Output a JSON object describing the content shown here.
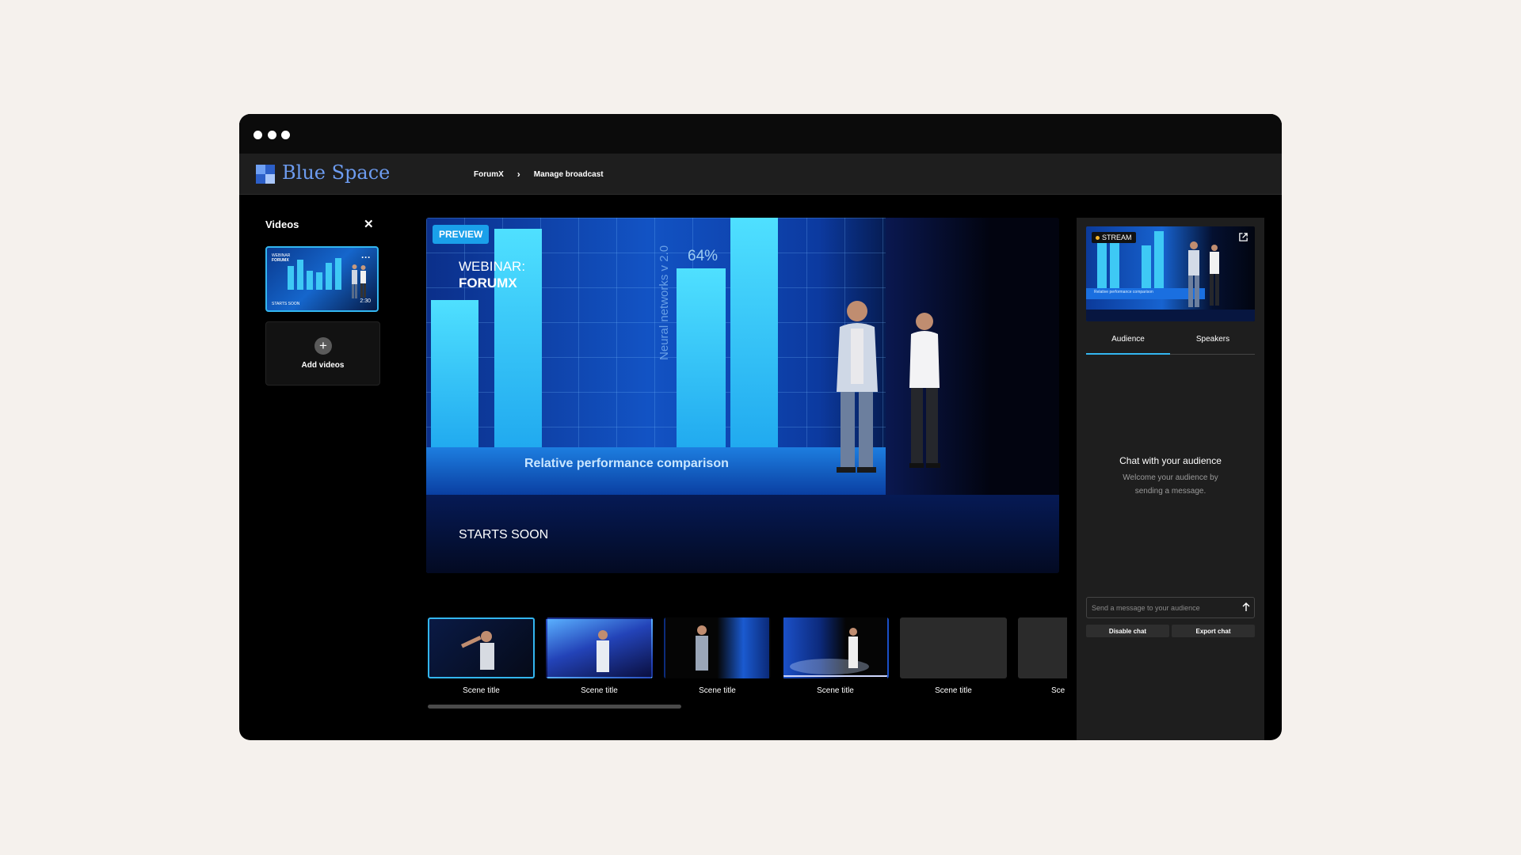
{
  "app": {
    "name": "Blue Space"
  },
  "breadcrumb": {
    "items": [
      "ForumX",
      "Manage broadcast"
    ]
  },
  "videos_panel": {
    "title": "Videos",
    "close_icon": "close-icon",
    "card": {
      "line1": "WEBINAR",
      "line2": "FORUMX",
      "caption": "STARTS SOON",
      "duration": "2:30"
    },
    "add_label": "Add videos"
  },
  "preview": {
    "badge": "PREVIEW",
    "title_line1": "WEBINAR:",
    "title_line2": "FORUMX",
    "status": "STARTS SOON",
    "screen_percent": "64%",
    "screen_vertical": "Neural networks v 2.0",
    "screen_caption": "Relative performance comparison"
  },
  "scenes": [
    {
      "label": "Scene title"
    },
    {
      "label": "Scene title"
    },
    {
      "label": "Scene title"
    },
    {
      "label": "Scene title"
    },
    {
      "label": "Scene title"
    },
    {
      "label": "Sce"
    }
  ],
  "stream": {
    "badge": "STREAM",
    "caption": "Relative performance comparison"
  },
  "chat": {
    "tabs": [
      "Audience",
      "Speakers"
    ],
    "active_tab": "Audience",
    "empty_title": "Chat with your audience",
    "empty_subtitle": "Welcome your audience by sending a message.",
    "input_placeholder": "Send a message to your audience",
    "disable_label": "Disable chat",
    "export_label": "Export chat"
  },
  "colors": {
    "accent": "#33b6f0",
    "brand": "#6d9cf0",
    "live": "#f5b62c"
  }
}
